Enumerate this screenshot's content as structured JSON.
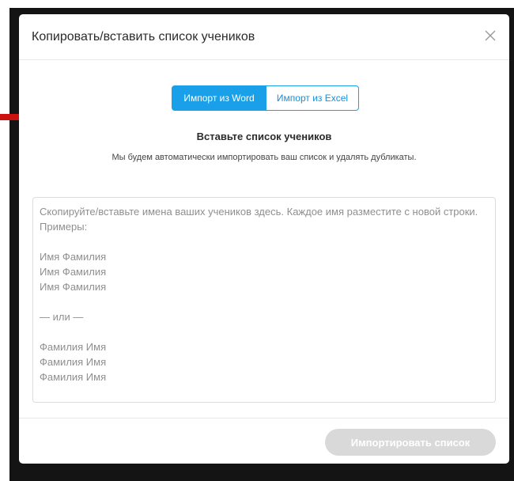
{
  "dialog": {
    "title": "Копировать/вставить список учеников",
    "close_icon": "close-icon"
  },
  "tabs": [
    {
      "label": "Импорт из Word",
      "active": true
    },
    {
      "label": "Импорт из Excel",
      "active": false
    }
  ],
  "content": {
    "heading": "Вставьте список учеников",
    "subtext": "Мы будем автоматически импортировать ваш список и удалять дубликаты."
  },
  "list_input": {
    "value": "",
    "placeholder": "Скопируйте/вставьте имена ваших учеников здесь. Каждое имя разместите с новой строки. Примеры:\n\nИмя Фамилия\nИмя Фамилия\nИмя Фамилия\n\n— или —\n\nФамилия Имя\nФамилия Имя\nФамилия Имя"
  },
  "footer": {
    "import_label": "Импортировать список",
    "import_enabled": false
  },
  "colors": {
    "accent": "#1aa0e8",
    "backdrop": "#141414",
    "annotation_arrow": "#cc1111",
    "button_disabled": "#d9d9d9"
  }
}
